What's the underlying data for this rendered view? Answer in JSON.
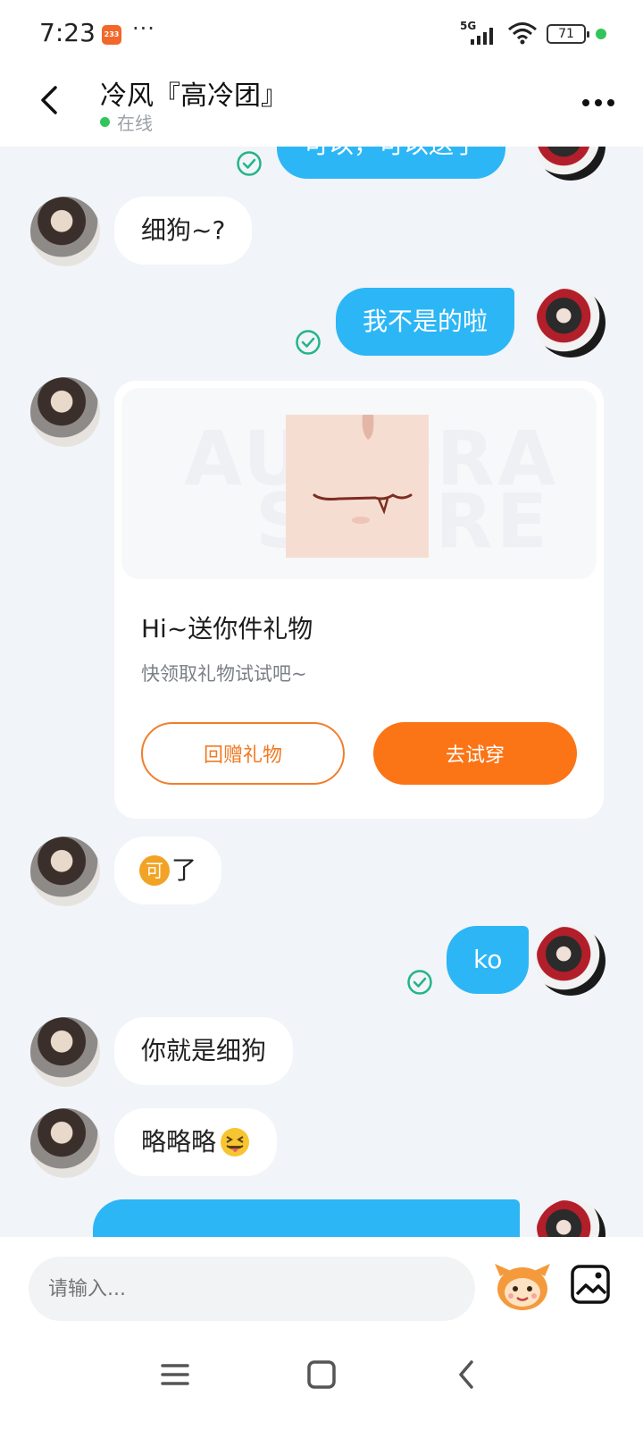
{
  "status_bar": {
    "time": "7:23",
    "app_badge": "233",
    "more": "···",
    "network": "5G",
    "battery": "71"
  },
  "header": {
    "title": "冷风『高冷团』",
    "status": "在线"
  },
  "messages": [
    {
      "side": "self",
      "text": "可以，可以送了",
      "partial": true
    },
    {
      "side": "other",
      "text": "细狗~?"
    },
    {
      "side": "self",
      "text": "我不是的啦"
    },
    {
      "side": "other",
      "type": "gift"
    },
    {
      "side": "other",
      "text": "了",
      "emoji": "可"
    },
    {
      "side": "self",
      "text": "ko"
    },
    {
      "side": "other",
      "text": "你就是细狗"
    },
    {
      "side": "other",
      "text": "略略略",
      "emoji": "tongue-face"
    }
  ],
  "gift_card": {
    "watermark_top": "AURORA",
    "watermark_bottom": "STORE",
    "title": "Hi~送你件礼物",
    "subtitle": "快领取礼物试试吧~",
    "return_gift_label": "回赠礼物",
    "try_on_label": "去试穿"
  },
  "input": {
    "placeholder": "请输入..."
  },
  "colors": {
    "bubble_out": "#2cb6f6",
    "accent_orange": "#fb7416",
    "online_green": "#31c55e",
    "read_check": "#23b48a"
  },
  "icons": [
    "back-icon",
    "more-icon",
    "read-check-icon",
    "mascot-emoji-icon",
    "image-icon",
    "nav-menu-icon",
    "nav-home-icon",
    "nav-back-icon"
  ]
}
